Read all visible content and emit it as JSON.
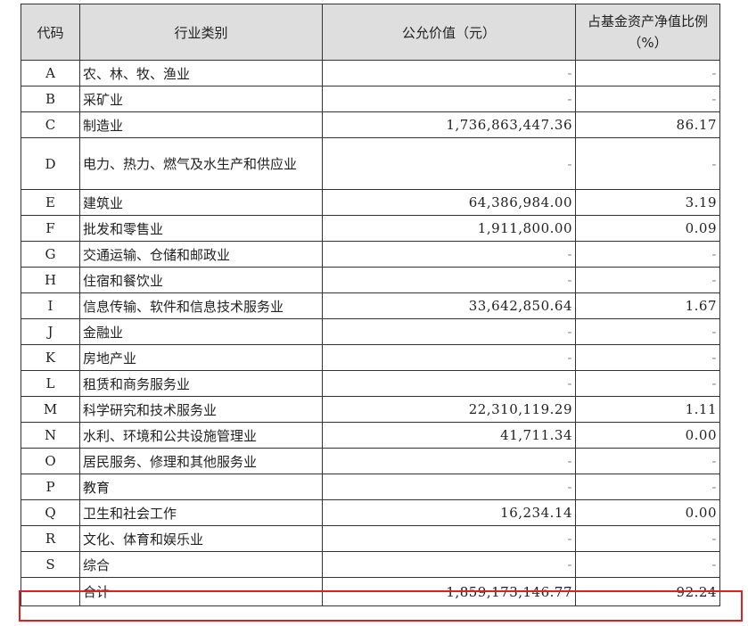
{
  "header": {
    "code": "代码",
    "category": "行业类别",
    "fair_value": "公允价值（元）",
    "nav_ratio": "占基金资产净值比例（%）"
  },
  "rows": [
    {
      "code": "A",
      "name": "农、林、牧、渔业",
      "value": "-",
      "pct": "-"
    },
    {
      "code": "B",
      "name": "采矿业",
      "value": "-",
      "pct": "-"
    },
    {
      "code": "C",
      "name": "制造业",
      "value": "1,736,863,447.36",
      "pct": "86.17"
    },
    {
      "code": "D",
      "name": "电力、热力、燃气及水生产和供应业",
      "value": "-",
      "pct": "-"
    },
    {
      "code": "E",
      "name": "建筑业",
      "value": "64,386,984.00",
      "pct": "3.19"
    },
    {
      "code": "F",
      "name": "批发和零售业",
      "value": "1,911,800.00",
      "pct": "0.09"
    },
    {
      "code": "G",
      "name": "交通运输、仓储和邮政业",
      "value": "-",
      "pct": "-"
    },
    {
      "code": "H",
      "name": "住宿和餐饮业",
      "value": "-",
      "pct": "-"
    },
    {
      "code": "I",
      "name": "信息传输、软件和信息技术服务业",
      "value": "33,642,850.64",
      "pct": "1.67"
    },
    {
      "code": "J",
      "name": "金融业",
      "value": "-",
      "pct": "-"
    },
    {
      "code": "K",
      "name": "房地产业",
      "value": "-",
      "pct": "-"
    },
    {
      "code": "L",
      "name": "租赁和商务服务业",
      "value": "-",
      "pct": "-"
    },
    {
      "code": "M",
      "name": "科学研究和技术服务业",
      "value": "22,310,119.29",
      "pct": "1.11"
    },
    {
      "code": "N",
      "name": "水利、环境和公共设施管理业",
      "value": "41,711.34",
      "pct": "0.00"
    },
    {
      "code": "O",
      "name": "居民服务、修理和其他服务业",
      "value": "-",
      "pct": "-"
    },
    {
      "code": "P",
      "name": "教育",
      "value": "-",
      "pct": "-"
    },
    {
      "code": "Q",
      "name": "卫生和社会工作",
      "value": "16,234.14",
      "pct": "0.00"
    },
    {
      "code": "R",
      "name": "文化、体育和娱乐业",
      "value": "-",
      "pct": "-"
    },
    {
      "code": "S",
      "name": "综合",
      "value": "-",
      "pct": "-"
    }
  ],
  "total": {
    "code": "",
    "name": "合计",
    "value": "1,859,173,146.77",
    "pct": "92.24"
  },
  "colors": {
    "header_bg": "#dedede",
    "highlight": "#e02020"
  }
}
